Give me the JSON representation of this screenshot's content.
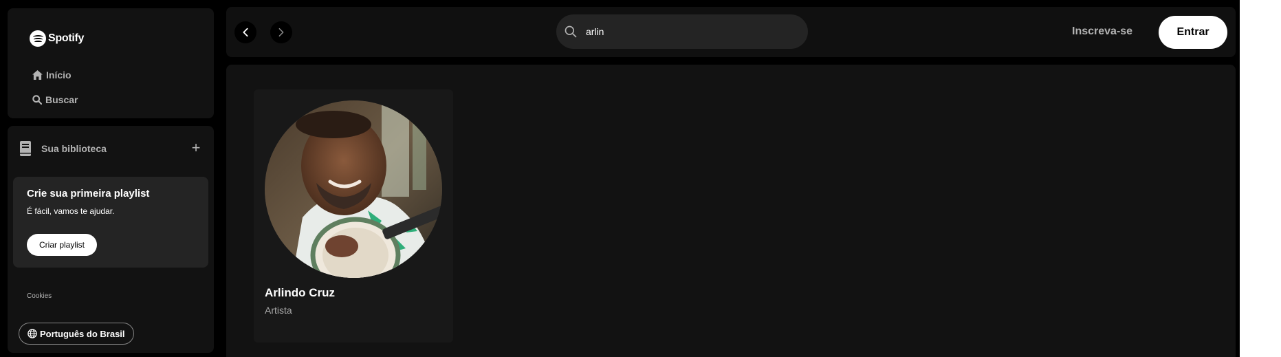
{
  "brand": {
    "name": "Spotify"
  },
  "nav": {
    "home_label": "Início",
    "search_label": "Buscar"
  },
  "library": {
    "title": "Sua biblioteca",
    "add_symbol": "+",
    "promo": {
      "title": "Crie sua primeira playlist",
      "subtitle": "É fácil, vamos te ajudar.",
      "button_label": "Criar playlist"
    },
    "cookies_label": "Cookies",
    "language_label": "Português do Brasil"
  },
  "topbar": {
    "search_value": "arlin",
    "signup_label": "Inscreva-se",
    "login_label": "Entrar"
  },
  "results": [
    {
      "name": "Arlindo Cruz",
      "type": "Artista"
    }
  ],
  "colors": {
    "background": "#000000",
    "panel": "#121212",
    "card": "#181818",
    "promo": "#242424",
    "text_primary": "#ffffff",
    "text_secondary": "#b3b3b3"
  }
}
